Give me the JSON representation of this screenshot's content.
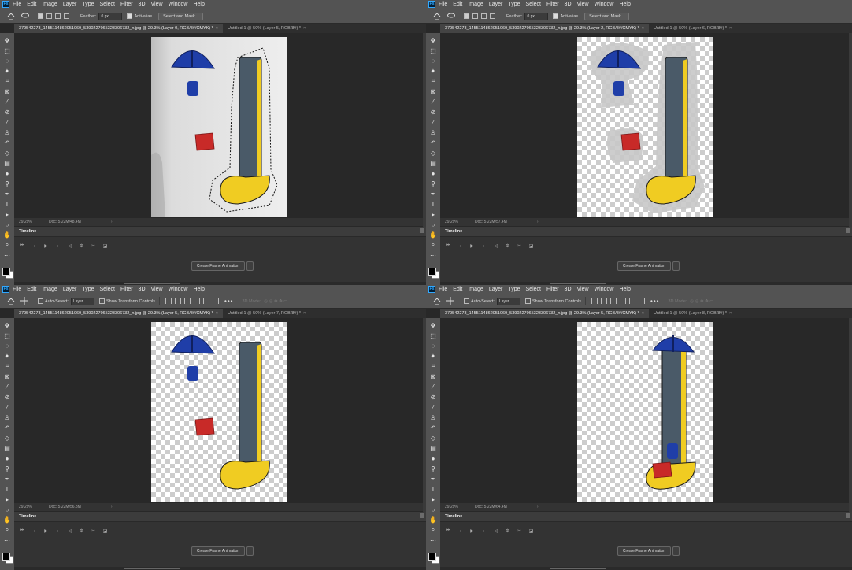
{
  "app": {
    "logo": "Ps",
    "menu": [
      "File",
      "Edit",
      "Image",
      "Layer",
      "Type",
      "Select",
      "Filter",
      "3D",
      "View",
      "Window",
      "Help"
    ]
  },
  "options_lasso": {
    "feather_label": "Feather:",
    "feather_value": "0 px",
    "anti_alias_label": "Anti-alias",
    "select_mask_label": "Select and Mask..."
  },
  "options_move": {
    "auto_select_label": "Auto-Select:",
    "auto_select_value": "Layer",
    "show_transform_label": "Show Transform Controls",
    "more_label": "•••",
    "mode_3d_label": "3D Mode:"
  },
  "panels": [
    {
      "tabs": [
        {
          "label": "379542273_1455114862051069_5390227065323306732_n.jpg @ 29.3% (Layer 0, RGB/8#/CMYK) *",
          "active": true
        },
        {
          "label": "Untitled-1 @ 50% (Layer 5, RGB/8#) *",
          "active": false
        }
      ],
      "zoom": "29.29%",
      "doc": "Doc: 5.22M/48.4M"
    },
    {
      "tabs": [
        {
          "label": "379542273_1455114862051069_5390227065323306732_n.jpg @ 29.3% (Layer 2, RGB/8#/CMYK) *",
          "active": true
        },
        {
          "label": "Untitled-1 @ 50% (Layer 6, RGB/8#) *",
          "active": false
        }
      ],
      "zoom": "29.29%",
      "doc": "Doc: 5.22M/57.4M"
    },
    {
      "tabs": [
        {
          "label": "379542273_1455114862051069_5390227065323306732_n.jpg @ 29.3% (Layer 5, RGB/8#/CMYK) *",
          "active": true
        },
        {
          "label": "Untitled-1 @ 50% (Layer 7, RGB/8#) *",
          "active": false
        }
      ],
      "zoom": "29.29%",
      "doc": "Doc: 5.22M/56.8M"
    },
    {
      "tabs": [
        {
          "label": "379542273_1455114862051069_5390227065323306732_n.jpg @ 29.3% (Layer 5, RGB/8#/CMYK) *",
          "active": true
        },
        {
          "label": "Untitled-1 @ 50% (Layer 8, RGB/8#) *",
          "active": false
        }
      ],
      "zoom": "29.29%",
      "doc": "Doc: 5.22M/64.4M"
    }
  ],
  "timeline": {
    "title": "Timeline",
    "create_label": "Create Frame Animation"
  },
  "colors": {
    "ui_panel": "#535353",
    "ui_dark": "#282828",
    "umbrella_blue": "#1f3ea8",
    "pillar": "#4a5a68",
    "yellow": "#f0cc22",
    "red": "#c82a28"
  },
  "icons": {
    "tools": [
      "move-icon",
      "marquee-icon",
      "lasso-icon",
      "magic-wand-icon",
      "crop-icon",
      "frame-icon",
      "eyedropper-icon",
      "healing-brush-icon",
      "brush-icon",
      "clone-stamp-icon",
      "history-brush-icon",
      "eraser-icon",
      "gradient-icon",
      "blur-icon",
      "dodge-icon",
      "pen-icon",
      "type-icon",
      "path-select-icon",
      "shape-icon",
      "hand-icon",
      "zoom-icon",
      "more-tools-icon"
    ]
  }
}
